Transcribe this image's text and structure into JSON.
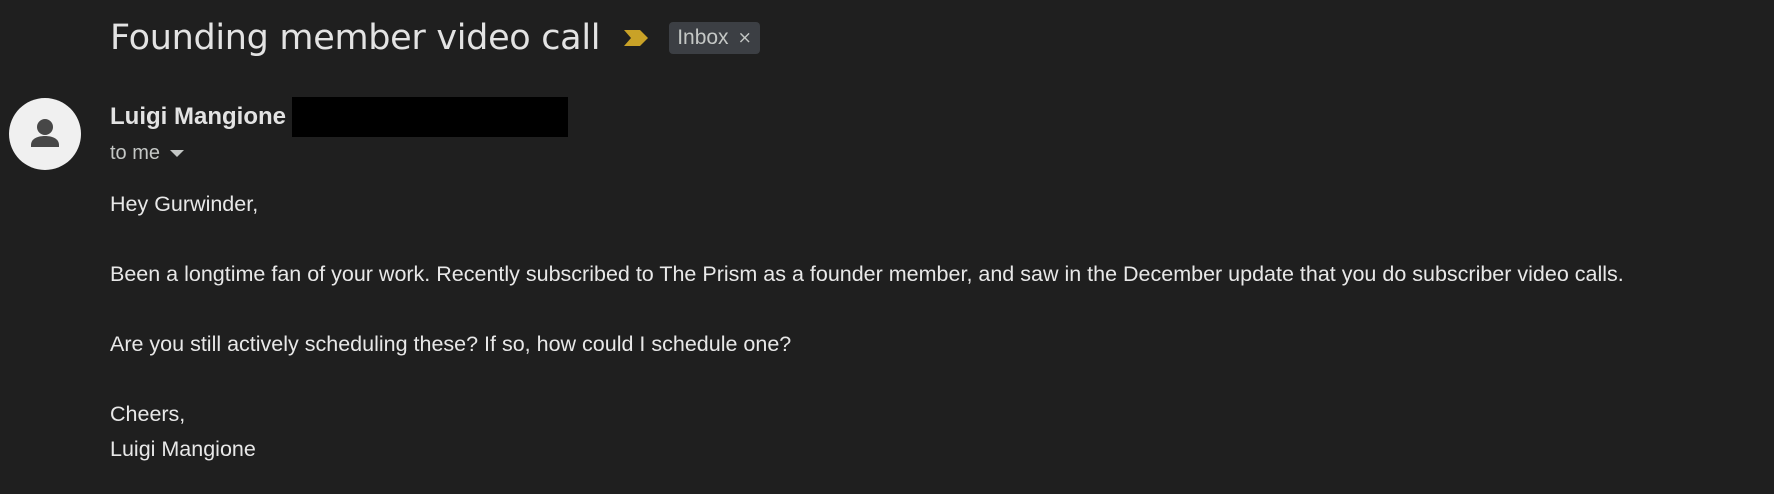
{
  "email": {
    "subject": "Founding member video call",
    "label": "Inbox",
    "label_close": "×",
    "importance_color": "#c9a227",
    "importance_icon": "importance-marker",
    "sender": {
      "name": "Luigi Mangione",
      "avatar_icon": "person-icon"
    },
    "recipient_text": "to me",
    "body": {
      "greeting": "Hey Gurwinder,",
      "paragraph1": "Been a longtime fan of your work. Recently subscribed to The Prism as a founder member, and saw in the December update that you do subscriber video calls.",
      "paragraph2": "Are you still actively scheduling these? If so, how could I schedule one?",
      "signoff": "Cheers,",
      "signature": "Luigi Mangione"
    }
  },
  "colors": {
    "background": "#1f1f1f",
    "text": "#e3e3e3",
    "label_bg": "#3c3f44",
    "avatar_bg": "#f0f0f0",
    "avatar_fg": "#474747"
  }
}
